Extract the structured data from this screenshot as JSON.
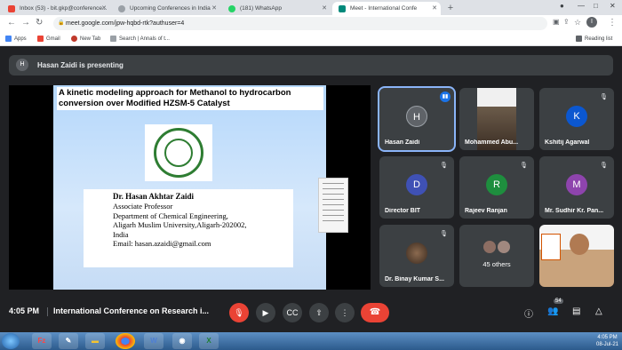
{
  "browser": {
    "tabs": [
      {
        "title": "Inbox (53) - bit.gkp@conference...",
        "color": "#ea4335"
      },
      {
        "title": "Upcoming Conferences in India",
        "color": "#5f6368"
      },
      {
        "title": "(181) WhatsApp",
        "color": "#25d366"
      },
      {
        "title": "Meet - International Confe",
        "color": "#00897b"
      }
    ],
    "url": "meet.google.com/jpw-hqbd-rtk?authuser=4",
    "bookmarks": [
      "Apps",
      "Gmail",
      "New Tab",
      "Search | Annals of t..."
    ],
    "reading_list": "Reading list",
    "profile_initial": "I"
  },
  "presenting_banner": {
    "avatar": "H",
    "text": "Hasan Zaidi is presenting"
  },
  "slide": {
    "title": "A kinetic modeling approach for Methanol to hydrocarbon conversion over Modified HZSM-5 Catalyst",
    "author": "Dr. Hasan Akhtar Zaidi",
    "lines": [
      "Associate Professor",
      "Department of Chemical Engineering,",
      "Aligarh Muslim University,Aligarh-202002,",
      "India",
      "Email: hasan.azaidi@gmail.com"
    ]
  },
  "participants": [
    {
      "name": "Hasan Zaidi",
      "initial": "H",
      "color": "#5f6368",
      "speaking": true
    },
    {
      "name": "Mohammed Abu...",
      "initial": "",
      "color": "#6b5b4a",
      "speaking": false
    },
    {
      "name": "Kshitij Agarwal",
      "initial": "K",
      "color": "#0b57d0",
      "speaking": false
    },
    {
      "name": "Director BIT",
      "initial": "D",
      "color": "#3f51b5",
      "speaking": false
    },
    {
      "name": "Rajeev Ranjan",
      "initial": "R",
      "color": "#1e8e3e",
      "speaking": false
    },
    {
      "name": "Mr. Sudhir Kr. Pan...",
      "initial": "M",
      "color": "#8e44ad",
      "speaking": false
    },
    {
      "name": "Dr. Binay Kumar S...",
      "initial": "",
      "color": "#4a4a4a",
      "speaking": false
    },
    {
      "name": "45 others",
      "initial": "",
      "color": "#3c4043",
      "speaking": false
    },
    {
      "name": "",
      "initial": "",
      "color": "#c9a37c",
      "speaking": false
    }
  ],
  "controls": {
    "time": "4:05 PM",
    "meeting_title": "International Conference on Research i...",
    "participant_count": "54"
  },
  "taskbar": {
    "time": "4:05 PM",
    "date": "08-Jul-21"
  }
}
